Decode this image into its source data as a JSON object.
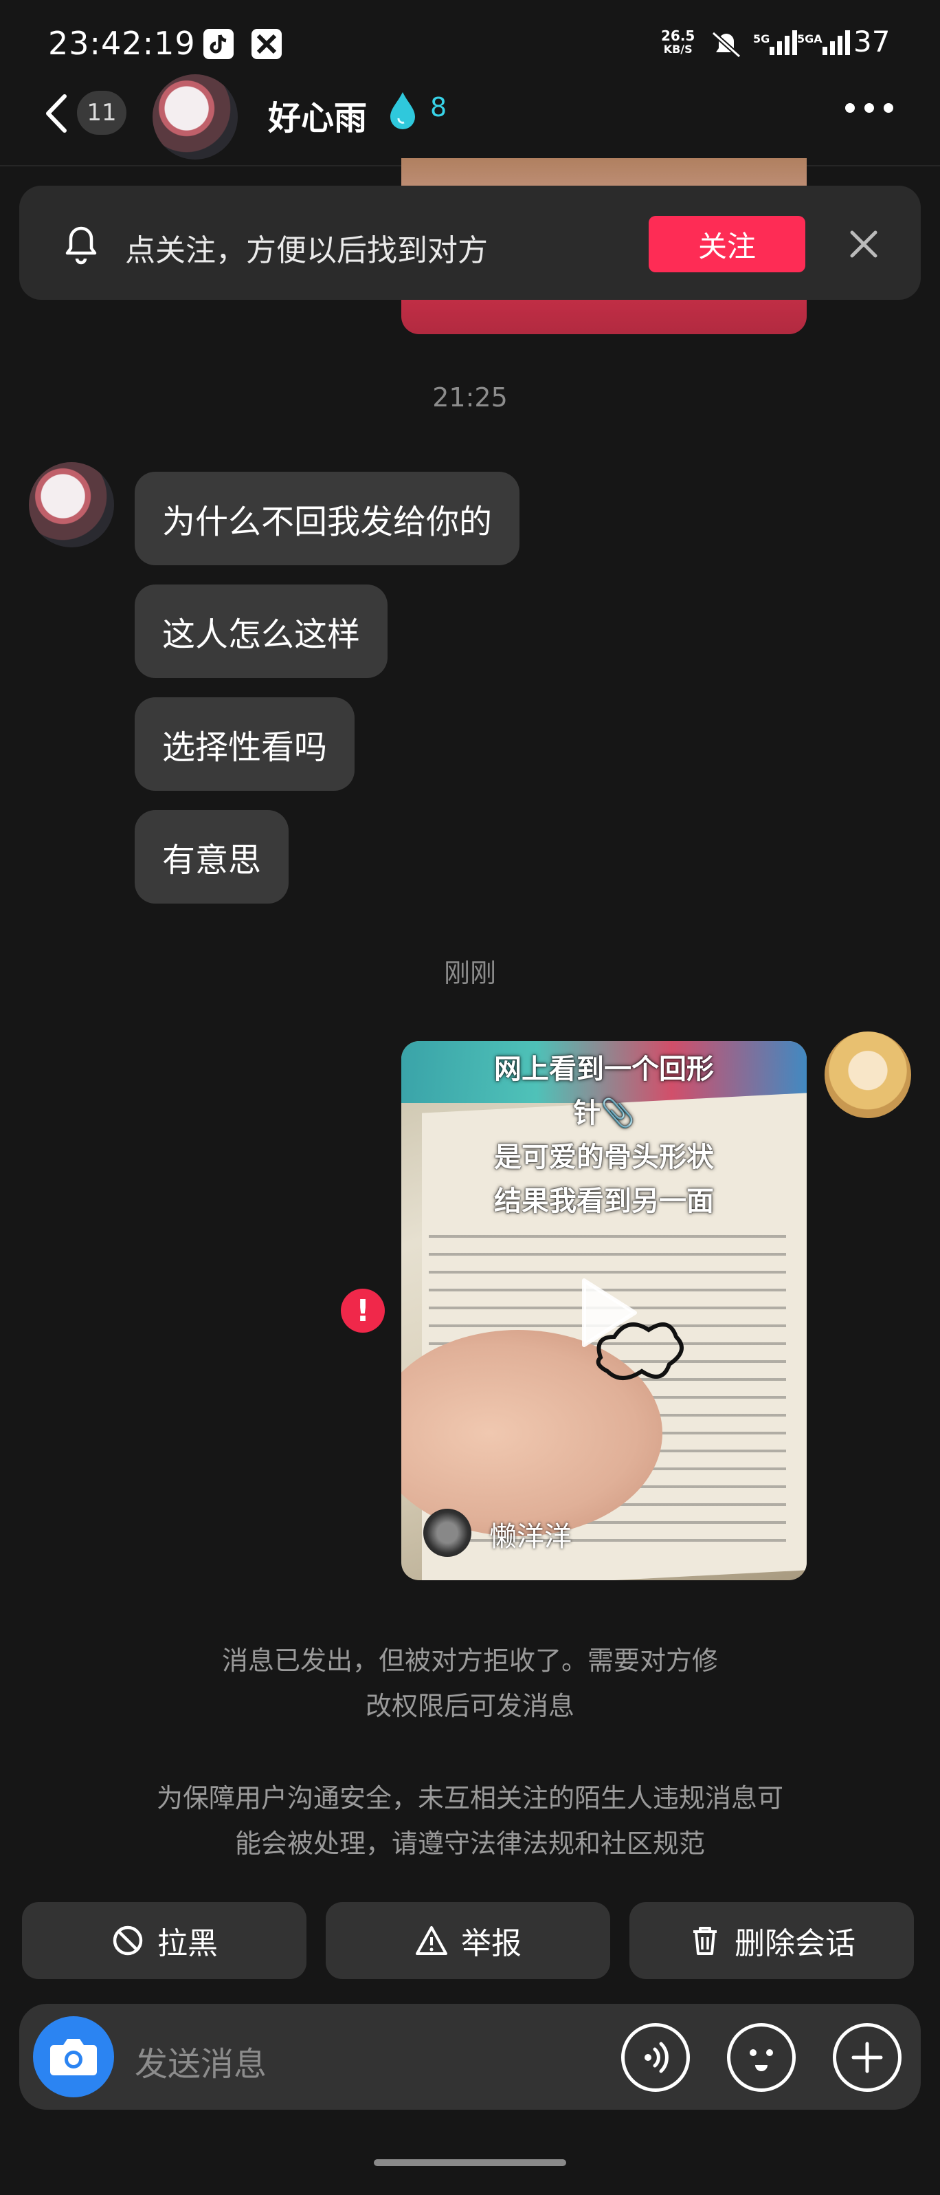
{
  "status_bar": {
    "time": "23:42:19",
    "net_speed_value": "26.5",
    "net_speed_unit": "KB/S",
    "sig1": "5G",
    "sig2": "5GA",
    "battery": "37"
  },
  "header": {
    "unread_count": "11",
    "contact_name": "好心雨",
    "spark_count": "8",
    "spark_color": "#38d3e8"
  },
  "follow_banner": {
    "text": "点关注，方便以后找到对方",
    "button_label": "关注",
    "button_color": "#fe2c55"
  },
  "messages": {
    "timestamp_1": "21:25",
    "incoming": [
      "为什么不回我发给你的",
      "这人怎么这样",
      "选择性看吗",
      "有意思"
    ],
    "timestamp_2": "刚刚",
    "video_card": {
      "caption_line1": "网上看到一个回形",
      "caption_line2": "针📎",
      "caption_line3": "是可爱的骨头形状",
      "caption_line4": "结果我看到另一面",
      "author": "懒洋洋"
    },
    "error_icon": "!"
  },
  "notices": {
    "rejected_line1": "消息已发出，但被对方拒收了。需要对方修",
    "rejected_line2": "改权限后可发消息",
    "safety_line1": "为保障用户沟通安全，未互相关注的陌生人违规消息可",
    "safety_line2": "能会被处理，请遵守法律法规和社区规范"
  },
  "actions": {
    "block": "拉黑",
    "report": "举报",
    "delete": "删除会话"
  },
  "input": {
    "placeholder": "发送消息"
  }
}
